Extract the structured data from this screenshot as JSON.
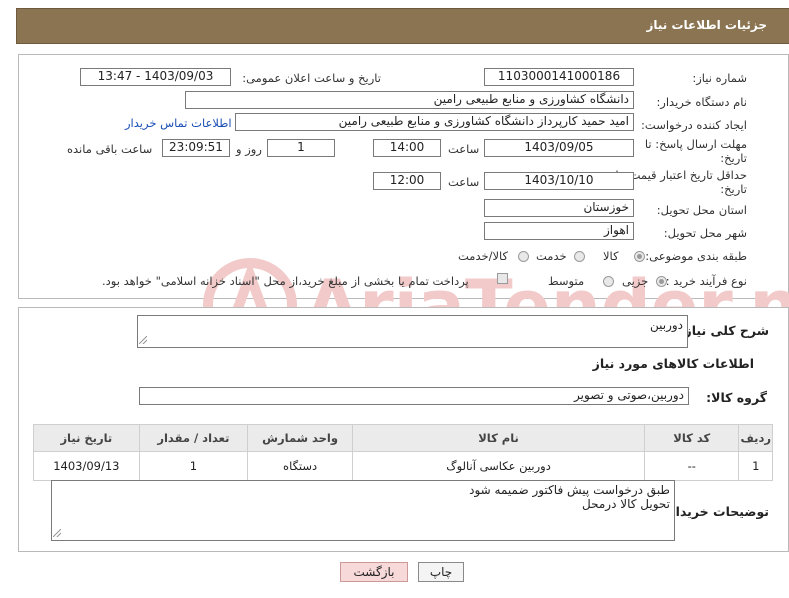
{
  "header": {
    "title": "جزئیات اطلاعات نیاز"
  },
  "form": {
    "need_number_label": "شماره نیاز:",
    "need_number": "1103000141000186",
    "announce_label": "تاریخ و ساعت اعلان عمومی:",
    "announce_value": "1403/09/03 - 13:47",
    "buyer_org_label": "نام دستگاه خریدار:",
    "buyer_org": "دانشگاه کشاورزی و منابع طبیعی رامین",
    "creator_label": "ایجاد کننده درخواست:",
    "creator": "امید حمید کارپرداز دانشگاه کشاورزی و منابع طبیعی رامین",
    "contact_link": "اطلاعات تماس خریدار",
    "reply_deadline_label": "مهلت ارسال پاسخ: تا تاریخ:",
    "reply_date": "1403/09/05",
    "time_label": "ساعت",
    "reply_time": "14:00",
    "days_value": "1",
    "days_label": "روز و",
    "remaining_time": "23:09:51",
    "remaining_label": "ساعت باقی مانده",
    "validity_label": "حداقل تاریخ اعتبار قیمت: تا تاریخ:",
    "validity_date": "1403/10/10",
    "validity_time": "12:00",
    "province_label": "استان محل تحویل:",
    "province": "خوزستان",
    "city_label": "شهر محل تحویل:",
    "city": "اهواز",
    "category_label": "طبقه بندی موضوعی:",
    "category_options": [
      "کالا",
      "خدمت",
      "کالا/خدمت"
    ],
    "purchase_type_label": "نوع فرآیند خرید :",
    "purchase_options": [
      "جزیی",
      "متوسط"
    ],
    "payment_note": "پرداخت تمام یا بخشی از مبلغ خرید،از محل \"اسناد خزانه اسلامی\" خواهد بود."
  },
  "details": {
    "general_desc_label": "شرح کلی نیاز:",
    "general_desc": "دوربین",
    "items_info_title": "اطلاعات کالاهای مورد نیاز",
    "group_label": "گروه کالا:",
    "group_value": "دوربین،صوتی و تصویر",
    "table": {
      "headers": [
        "ردیف",
        "کد کالا",
        "نام کالا",
        "واحد شمارش",
        "تعداد / مقدار",
        "تاریخ نیاز"
      ],
      "rows": [
        [
          "1",
          "--",
          "دوربین عکاسی آنالوگ",
          "دستگاه",
          "1",
          "1403/09/13"
        ]
      ]
    },
    "buyer_notes_label": "توضیحات خریدار:",
    "buyer_notes": "طبق درخواست پیش فاکتور ضمیمه شود\nتحویل کالا درمحل"
  },
  "buttons": {
    "print": "چاپ",
    "back": "بازگشت"
  },
  "watermark": {
    "text": "AriaTender.neT"
  },
  "colors": {
    "header_bg": "#8b7451",
    "link": "#1a4fb5",
    "back_btn_bg": "#f7d9d9",
    "watermark": "#f2caca"
  }
}
